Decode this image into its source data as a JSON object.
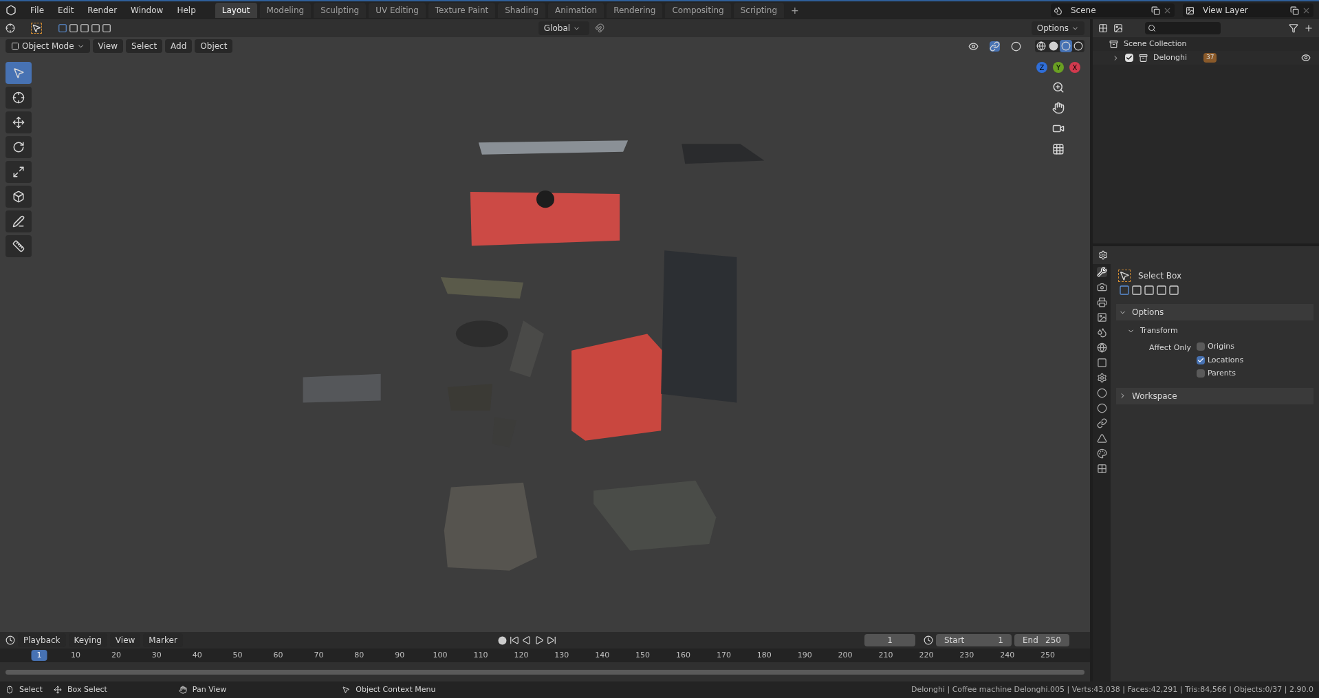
{
  "menu": [
    "File",
    "Edit",
    "Render",
    "Window",
    "Help"
  ],
  "workspaces": [
    {
      "label": "Layout",
      "selected": true
    },
    {
      "label": "Modeling",
      "selected": false
    },
    {
      "label": "Sculpting",
      "selected": false
    },
    {
      "label": "UV Editing",
      "selected": false
    },
    {
      "label": "Texture Paint",
      "selected": false
    },
    {
      "label": "Shading",
      "selected": false
    },
    {
      "label": "Animation",
      "selected": false
    },
    {
      "label": "Rendering",
      "selected": false
    },
    {
      "label": "Compositing",
      "selected": false
    },
    {
      "label": "Scripting",
      "selected": false
    }
  ],
  "add_workspace": "+",
  "scene": "Scene",
  "view_layer": "View Layer",
  "viewport": {
    "orientation": "Global",
    "options": "Options",
    "mode": "Object Mode",
    "menus": [
      "View",
      "Select",
      "Add",
      "Object"
    ],
    "shading": [
      {
        "kind": "wireframe",
        "selected": false
      },
      {
        "kind": "solid",
        "selected": false
      },
      {
        "kind": "material",
        "selected": true
      },
      {
        "kind": "rendered",
        "selected": false
      }
    ],
    "tools": [
      {
        "kind": "select",
        "selected": true
      },
      {
        "kind": "cursor",
        "selected": false
      },
      {
        "kind": "move",
        "selected": false
      },
      {
        "kind": "rotate",
        "selected": false
      },
      {
        "kind": "scale",
        "selected": false
      },
      {
        "kind": "transform",
        "selected": false
      },
      {
        "kind": "annotate",
        "selected": false
      },
      {
        "kind": "measure",
        "selected": false
      }
    ],
    "gizmo": [
      {
        "label": "Z",
        "color": "#2f6ed8"
      },
      {
        "label": "Y",
        "color": "#6aa023"
      },
      {
        "label": "X",
        "color": "#d23a4e"
      }
    ]
  },
  "outliner": {
    "items": [
      {
        "label": "Scene Collection",
        "children": [
          {
            "label": "Delonghi",
            "checked": true,
            "expanded": false,
            "count": "37"
          }
        ]
      }
    ]
  },
  "properties": {
    "tabs": [
      {
        "kind": "tool",
        "selected": true
      },
      {
        "kind": "render",
        "selected": false
      },
      {
        "kind": "output",
        "selected": false
      },
      {
        "kind": "view_layer",
        "selected": false
      },
      {
        "kind": "scene",
        "selected": false
      },
      {
        "kind": "world",
        "selected": false
      },
      {
        "kind": "object",
        "selected": false
      },
      {
        "kind": "modifiers",
        "selected": false
      },
      {
        "kind": "particles",
        "selected": false
      },
      {
        "kind": "physics",
        "selected": false
      },
      {
        "kind": "constraints",
        "selected": false
      },
      {
        "kind": "data",
        "selected": false
      },
      {
        "kind": "material",
        "selected": false
      },
      {
        "kind": "texture",
        "selected": false
      }
    ],
    "tool": "Select Box",
    "modes": [
      {
        "selected": true
      },
      {
        "selected": false
      },
      {
        "selected": false
      },
      {
        "selected": false
      },
      {
        "selected": false
      }
    ],
    "options": {
      "label": "Options",
      "expanded": true
    },
    "transform": {
      "label": "Transform",
      "expanded": true
    },
    "affect_label": "Affect Only",
    "affect": [
      {
        "label": "Origins",
        "checked": false
      },
      {
        "label": "Locations",
        "checked": true
      },
      {
        "label": "Parents",
        "checked": false
      }
    ],
    "workspace": {
      "label": "Workspace",
      "expanded": false
    }
  },
  "timeline": {
    "menus": [
      "Playback",
      "Keying",
      "View",
      "Marker"
    ],
    "current": "1",
    "start_label": "Start",
    "start": "1",
    "end_label": "End",
    "end": "250",
    "ticks": [
      "1",
      "10",
      "20",
      "30",
      "40",
      "50",
      "60",
      "70",
      "80",
      "90",
      "100",
      "110",
      "120",
      "130",
      "140",
      "150",
      "160",
      "170",
      "180",
      "190",
      "200",
      "210",
      "220",
      "230",
      "240",
      "250"
    ]
  },
  "status": {
    "hints": [
      {
        "kind": "left",
        "label": "Select"
      },
      {
        "kind": "drag",
        "label": "Box Select"
      },
      {
        "kind": "middle",
        "label": "Pan View"
      },
      {
        "kind": "right",
        "label": "Object Context Menu"
      }
    ],
    "stats": "Delonghi | Coffee machine Delonghi.005 | Verts:43,038 | Faces:42,291 | Tris:84,566 | Objects:0/37 | 2.90.0"
  }
}
